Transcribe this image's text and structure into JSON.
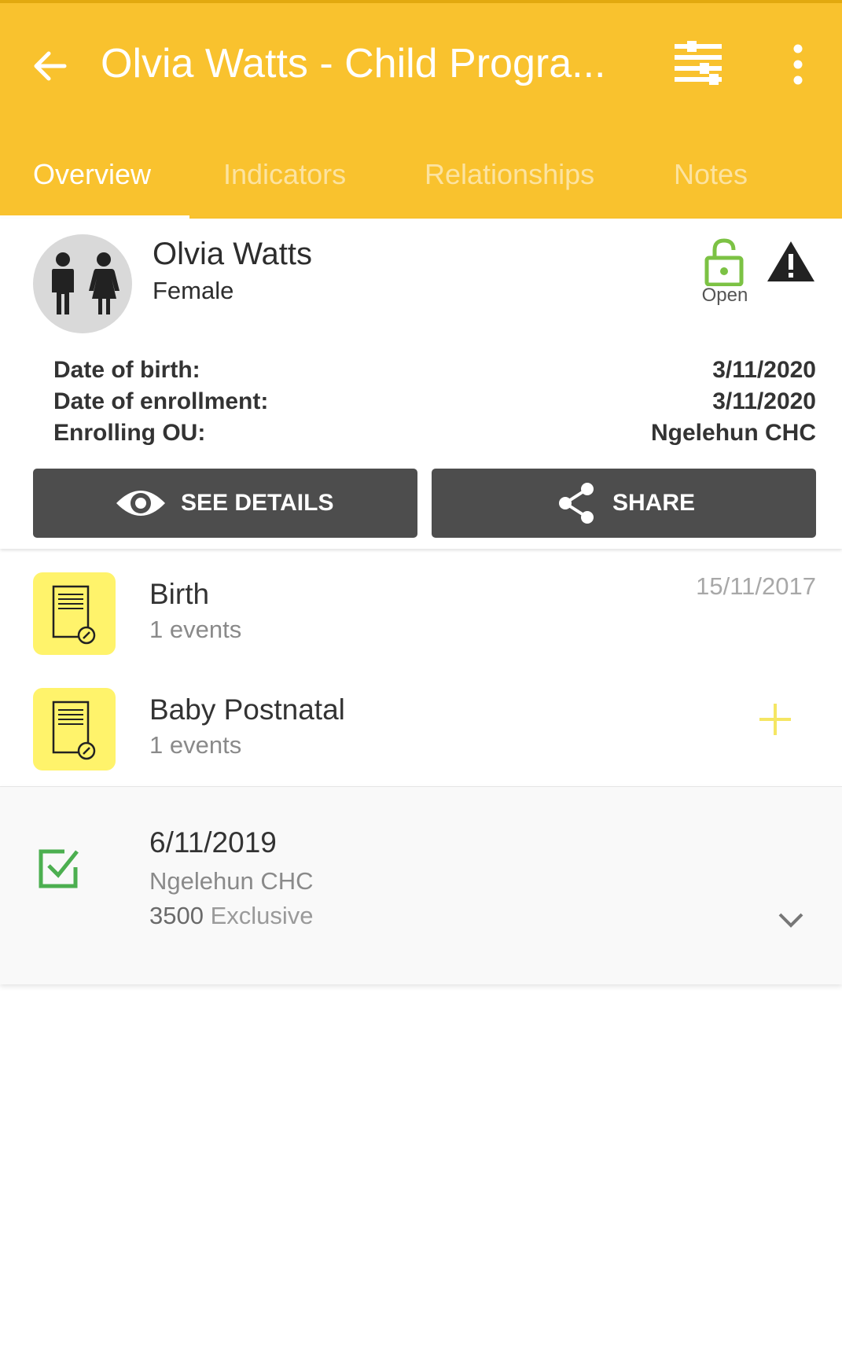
{
  "appbar": {
    "title": "Olvia Watts - Child Progra...",
    "icons": {
      "back": "arrow-back-icon",
      "filter": "filter-icon",
      "more": "more-vert-icon"
    }
  },
  "tabs": [
    {
      "label": "Overview",
      "active": true
    },
    {
      "label": "Indicators",
      "active": false
    },
    {
      "label": "Relationships",
      "active": false
    },
    {
      "label": "Notes",
      "active": false
    }
  ],
  "profile": {
    "name": "Olvia Watts",
    "gender": "Female",
    "status_label": "Open",
    "status_color": "#7CC244",
    "info": [
      {
        "label": "Date of birth:",
        "value": "3/11/2020"
      },
      {
        "label": "Date of enrollment:",
        "value": "3/11/2020"
      },
      {
        "label": "Enrolling OU:",
        "value": "Ngelehun CHC"
      }
    ],
    "buttons": {
      "details": "SEE DETAILS",
      "share": "SHARE"
    }
  },
  "stages": [
    {
      "title": "Birth",
      "subtitle": "1 events",
      "date": "15/11/2017"
    },
    {
      "title": "Baby Postnatal",
      "subtitle": "1 events",
      "date": ""
    }
  ],
  "event": {
    "date": "6/11/2019",
    "org_unit": "Ngelehun CHC",
    "data_value": "3500",
    "data_label": "Exclusive",
    "status_color": "#4CAF50"
  },
  "colors": {
    "primary": "#F9C22E",
    "stage_icon_bg": "#FFF36B",
    "button_bg": "#4D4D4D",
    "add_color": "#F5E663"
  }
}
